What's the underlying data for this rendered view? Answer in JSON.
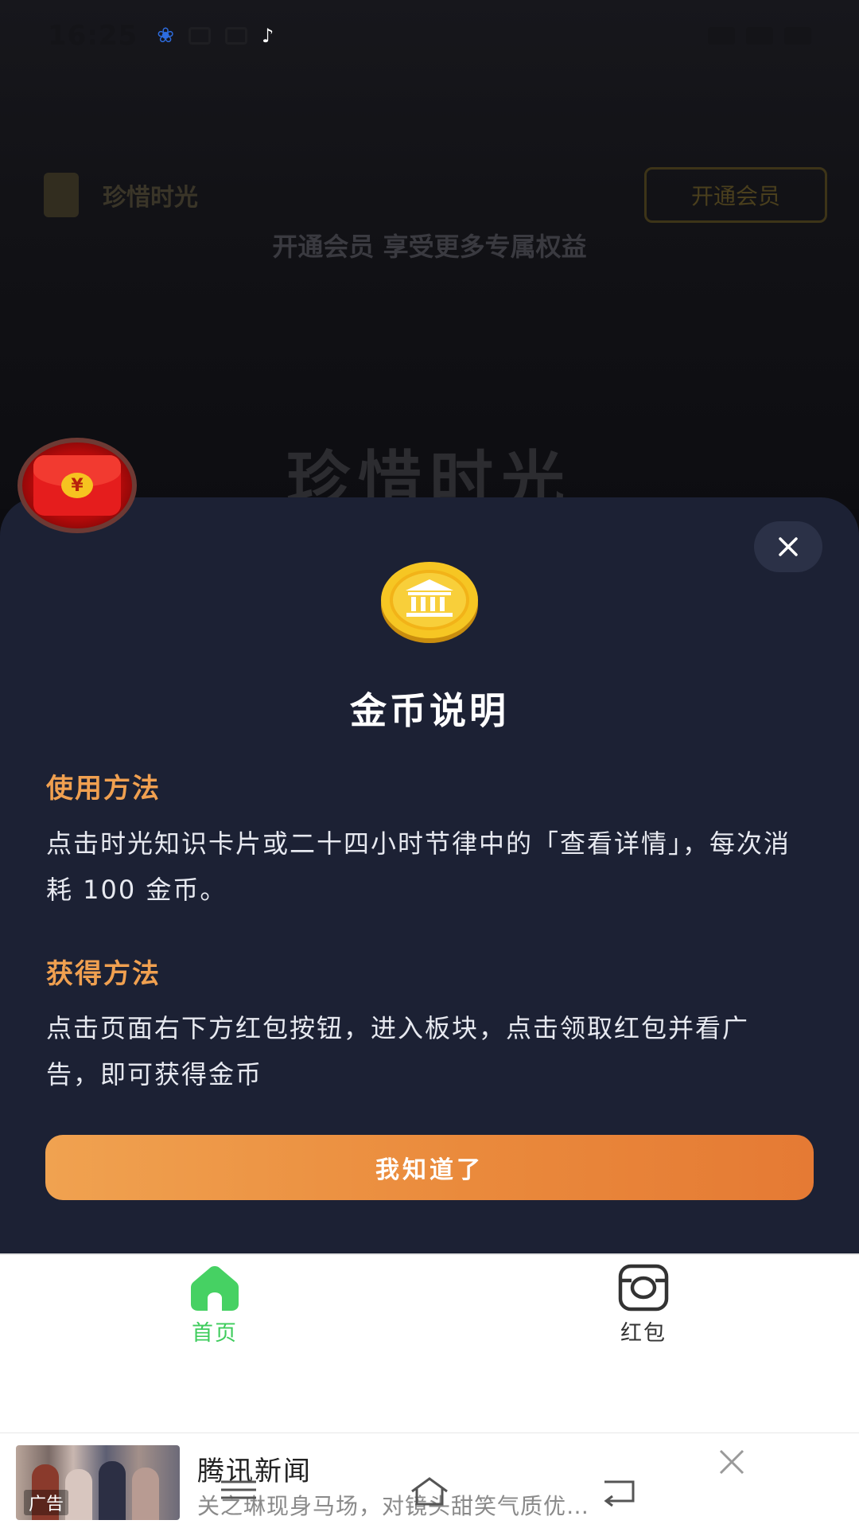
{
  "status_bar": {
    "time": "16:25"
  },
  "background_page": {
    "app_name": "珍惜时光",
    "vip_button": "开通会员",
    "subtitle": "开通会员 享受更多专属权益",
    "hero_title": "珍惜时光"
  },
  "floating_red_packet": {
    "coin_symbol": "¥"
  },
  "modal": {
    "title": "金币说明",
    "sections": [
      {
        "heading": "使用方法",
        "body": "点击时光知识卡片或二十四小时节律中的「查看详情」，每次消耗 100 金币。"
      },
      {
        "heading": "获得方法",
        "body": "点击页面右下方红包按钮，进入板块，点击领取红包并看广告，即可获得金币"
      }
    ],
    "confirm_label": "我知道了"
  },
  "tabbar": {
    "tabs": [
      {
        "label": "首页",
        "icon": "home-icon",
        "active": true
      },
      {
        "label": "红包",
        "icon": "camera-icon",
        "active": false
      }
    ],
    "active_color": "#3ecc5c"
  },
  "ad": {
    "title": "腾讯新闻",
    "description": "关之琳现身马场，对镜头甜笑气质优…",
    "tag": "广告"
  },
  "colors": {
    "modal_bg": "#1c2134",
    "heading_accent": "#f0a050",
    "button_gradient_start": "#f0a250",
    "button_gradient_end": "#e57a34"
  }
}
